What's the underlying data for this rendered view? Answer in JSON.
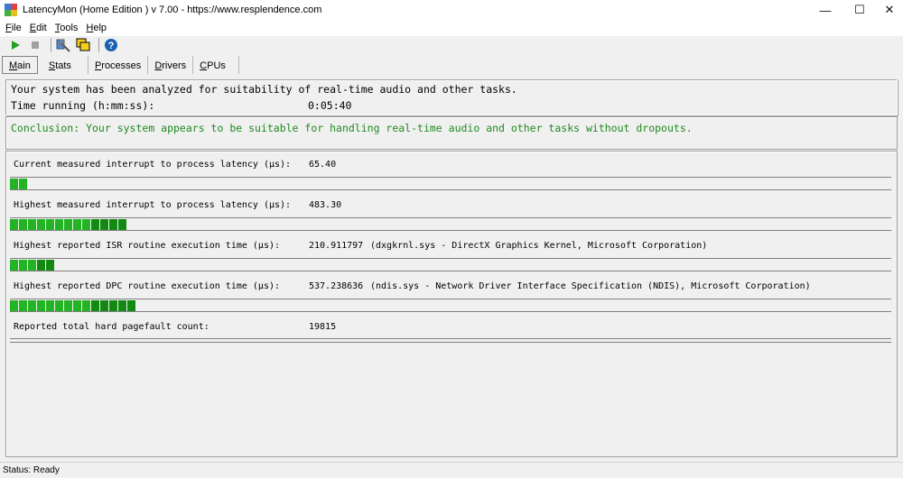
{
  "window": {
    "title": "LatencyMon  (Home Edition )  v 7.00 - https://www.resplendence.com",
    "minimize": "—",
    "maximize": "☐",
    "close": "✕"
  },
  "menu": [
    {
      "label": "File",
      "accel": "F",
      "rest": "ile"
    },
    {
      "label": "Edit",
      "accel": "E",
      "rest": "dit"
    },
    {
      "label": "Tools",
      "accel": "T",
      "rest": "ools"
    },
    {
      "label": "Help",
      "accel": "H",
      "rest": "elp"
    }
  ],
  "toolbar": {
    "icons": [
      "play-icon",
      "stop-icon",
      "tools-icon",
      "windows-icon",
      "help-icon"
    ],
    "colors": {
      "play": "#22a022",
      "stop": "#a0a0a0",
      "help": "#1a5fb4"
    }
  },
  "tabs": [
    {
      "label": "Main",
      "accel": "M",
      "rest": "ain",
      "active": true
    },
    {
      "label": "Stats",
      "accel": "S",
      "rest": "tats"
    },
    {
      "label": "Processes",
      "accel": "P",
      "rest": "rocesses"
    },
    {
      "label": "Drivers",
      "accel": "D",
      "rest": "rivers"
    },
    {
      "label": "CPUs",
      "accel": "C",
      "rest": "PUs"
    }
  ],
  "summary": {
    "analyzed_text": "Your system has been analyzed for suitability of real-time audio and other tasks.",
    "time_label": "Time running (h:mm:ss):",
    "time_value": "0:05:40",
    "conclusion": "Conclusion: Your system appears to be suitable for handling real-time audio and other tasks without dropouts.",
    "conclusion_color": "#1f8a1f"
  },
  "metrics": [
    {
      "label": "Current measured interrupt to process latency (µs):",
      "value": "65.40",
      "detail": "",
      "bar_fraction": 0.021
    },
    {
      "label": "Highest measured interrupt to process latency (µs):",
      "value": "483.30",
      "detail": "",
      "bar_fraction": 0.137
    },
    {
      "label": "Highest reported ISR routine execution time (µs):",
      "value": "210.911797",
      "detail": "(dxgkrnl.sys - DirectX Graphics Kernel, Microsoft Corporation)",
      "bar_fraction": 0.056
    },
    {
      "label": "Highest reported DPC routine execution time (µs):",
      "value": "537.238636",
      "detail": "(ndis.sys - Network Driver Interface Specification (NDIS), Microsoft Corporation)",
      "bar_fraction": 0.148
    }
  ],
  "pagefault": {
    "label": "Reported total hard pagefault count:",
    "value": "19815"
  },
  "status": "Status: Ready"
}
